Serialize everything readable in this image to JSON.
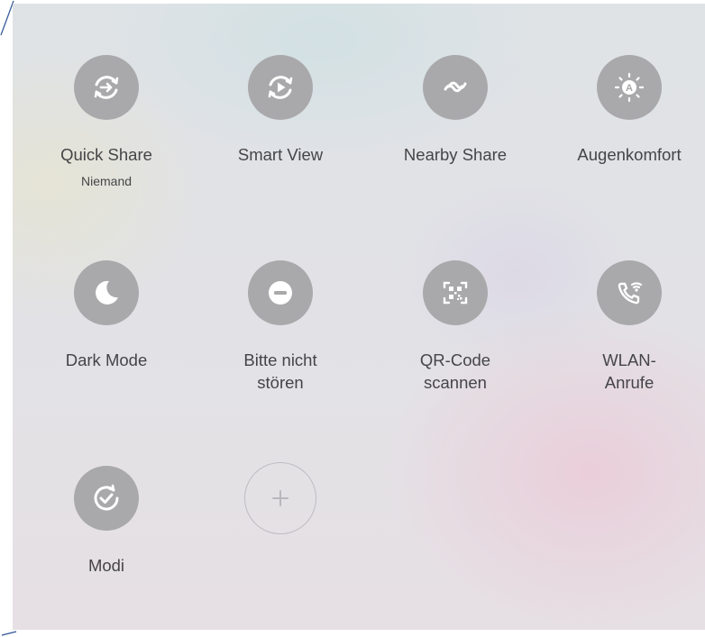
{
  "tiles": [
    {
      "label": "Quick Share",
      "sublabel": "Niemand",
      "icon": "quick-share-icon"
    },
    {
      "label": "Smart View",
      "icon": "smart-view-icon"
    },
    {
      "label": "Nearby Share",
      "icon": "nearby-share-icon"
    },
    {
      "label": "Augenkomfort",
      "icon": "eye-comfort-icon"
    },
    {
      "label": "Dark Mode",
      "icon": "moon-icon"
    },
    {
      "label": "Bitte nicht\nstören",
      "icon": "do-not-disturb-icon"
    },
    {
      "label": "QR-Code\nscannen",
      "icon": "qr-code-icon"
    },
    {
      "label": "WLAN-\nAnrufe",
      "icon": "wifi-call-icon"
    },
    {
      "label": "Modi",
      "icon": "modes-icon"
    }
  ],
  "add_button": {
    "glyph": "+",
    "icon": "plus-icon"
  },
  "colors": {
    "icon_circle": "#a9a9ab",
    "icon_glyph": "#ffffff",
    "label_text": "#454547",
    "add_border": "#bcbcc0"
  }
}
